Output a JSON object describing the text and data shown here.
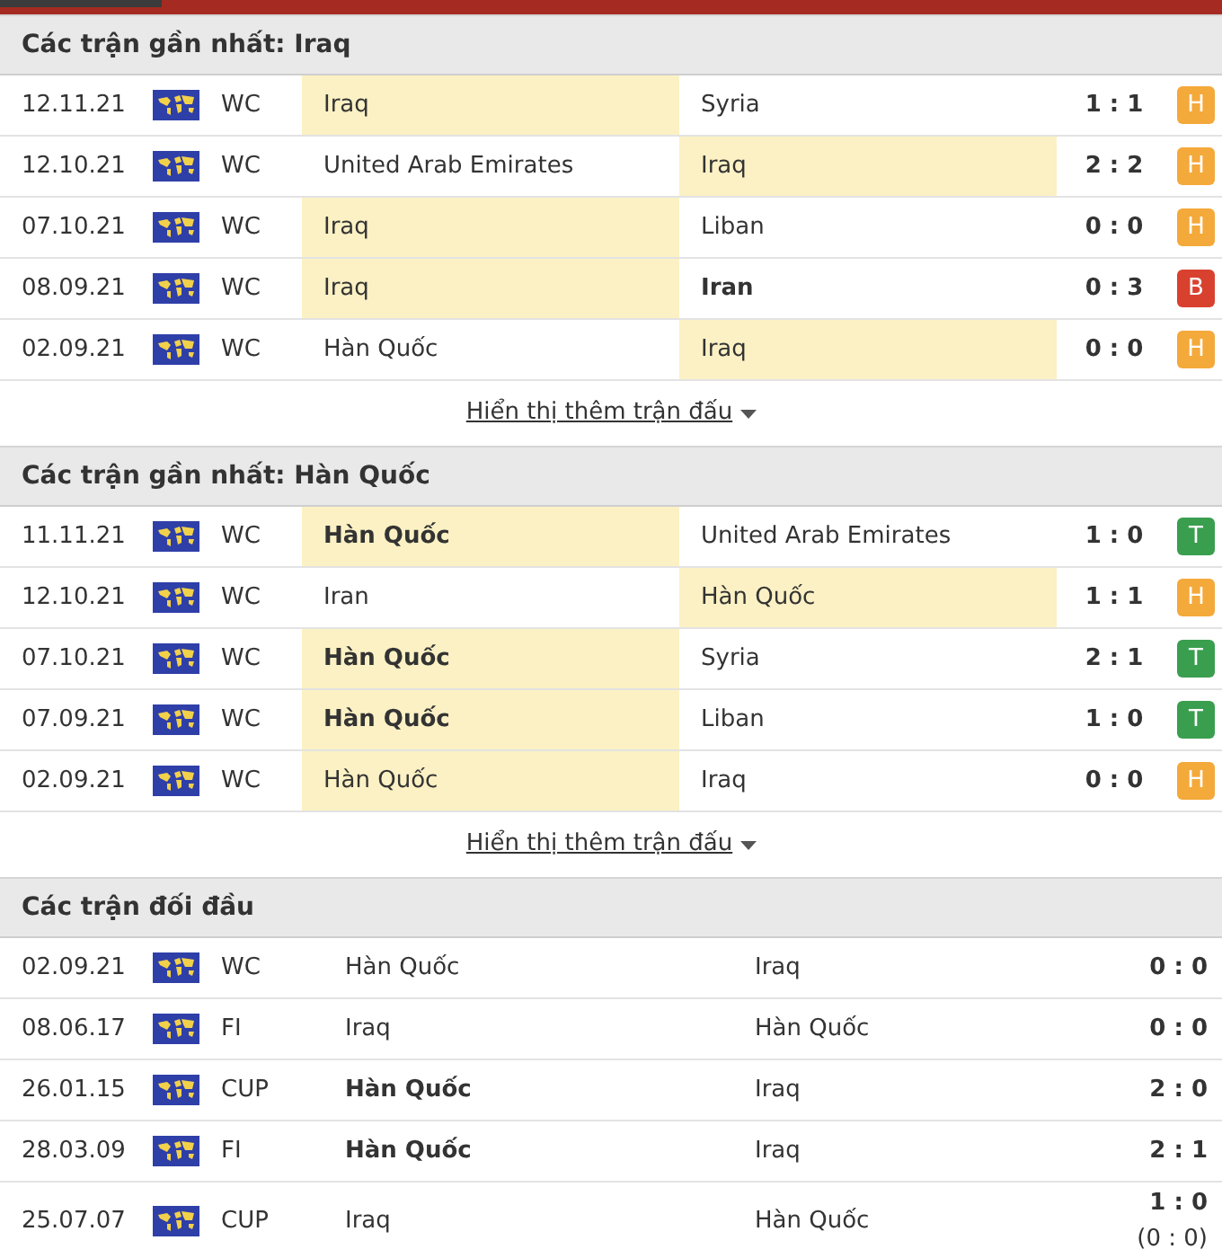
{
  "sections": [
    {
      "title": "Các trận gần nhất: Iraq",
      "show_more": "Hiển thị thêm trận đấu",
      "matches": [
        {
          "date": "12.11.21",
          "competition": "WC",
          "home": {
            "name": "Iraq",
            "bold": false,
            "highlighted": true
          },
          "away": {
            "name": "Syria",
            "bold": false,
            "highlighted": false
          },
          "score": "1 : 1",
          "result": {
            "label": "H",
            "kind": "draw"
          }
        },
        {
          "date": "12.10.21",
          "competition": "WC",
          "home": {
            "name": "United Arab Emirates",
            "bold": false,
            "highlighted": false
          },
          "away": {
            "name": "Iraq",
            "bold": false,
            "highlighted": true
          },
          "score": "2 : 2",
          "result": {
            "label": "H",
            "kind": "draw"
          }
        },
        {
          "date": "07.10.21",
          "competition": "WC",
          "home": {
            "name": "Iraq",
            "bold": false,
            "highlighted": true
          },
          "away": {
            "name": "Liban",
            "bold": false,
            "highlighted": false
          },
          "score": "0 : 0",
          "result": {
            "label": "H",
            "kind": "draw"
          }
        },
        {
          "date": "08.09.21",
          "competition": "WC",
          "home": {
            "name": "Iraq",
            "bold": false,
            "highlighted": true
          },
          "away": {
            "name": "Iran",
            "bold": true,
            "highlighted": false
          },
          "score": "0 : 3",
          "result": {
            "label": "B",
            "kind": "loss"
          }
        },
        {
          "date": "02.09.21",
          "competition": "WC",
          "home": {
            "name": "Hàn Quốc",
            "bold": false,
            "highlighted": false
          },
          "away": {
            "name": "Iraq",
            "bold": false,
            "highlighted": true
          },
          "score": "0 : 0",
          "result": {
            "label": "H",
            "kind": "draw"
          }
        }
      ]
    },
    {
      "title": "Các trận gần nhất: Hàn Quốc",
      "show_more": "Hiển thị thêm trận đấu",
      "matches": [
        {
          "date": "11.11.21",
          "competition": "WC",
          "home": {
            "name": "Hàn Quốc",
            "bold": true,
            "highlighted": true
          },
          "away": {
            "name": "United Arab Emirates",
            "bold": false,
            "highlighted": false
          },
          "score": "1 : 0",
          "result": {
            "label": "T",
            "kind": "win"
          }
        },
        {
          "date": "12.10.21",
          "competition": "WC",
          "home": {
            "name": "Iran",
            "bold": false,
            "highlighted": false
          },
          "away": {
            "name": "Hàn Quốc",
            "bold": false,
            "highlighted": true
          },
          "score": "1 : 1",
          "result": {
            "label": "H",
            "kind": "draw"
          }
        },
        {
          "date": "07.10.21",
          "competition": "WC",
          "home": {
            "name": "Hàn Quốc",
            "bold": true,
            "highlighted": true
          },
          "away": {
            "name": "Syria",
            "bold": false,
            "highlighted": false
          },
          "score": "2 : 1",
          "result": {
            "label": "T",
            "kind": "win"
          }
        },
        {
          "date": "07.09.21",
          "competition": "WC",
          "home": {
            "name": "Hàn Quốc",
            "bold": true,
            "highlighted": true
          },
          "away": {
            "name": "Liban",
            "bold": false,
            "highlighted": false
          },
          "score": "1 : 0",
          "result": {
            "label": "T",
            "kind": "win"
          }
        },
        {
          "date": "02.09.21",
          "competition": "WC",
          "home": {
            "name": "Hàn Quốc",
            "bold": false,
            "highlighted": true
          },
          "away": {
            "name": "Iraq",
            "bold": false,
            "highlighted": false
          },
          "score": "0 : 0",
          "result": {
            "label": "H",
            "kind": "draw"
          }
        }
      ]
    },
    {
      "title": "Các trận đối đầu",
      "matches": [
        {
          "date": "02.09.21",
          "competition": "WC",
          "home": {
            "name": "Hàn Quốc",
            "bold": false,
            "highlighted": false
          },
          "away": {
            "name": "Iraq",
            "bold": false,
            "highlighted": false
          },
          "score": "0 : 0"
        },
        {
          "date": "08.06.17",
          "competition": "FI",
          "home": {
            "name": "Iraq",
            "bold": false,
            "highlighted": false
          },
          "away": {
            "name": "Hàn Quốc",
            "bold": false,
            "highlighted": false
          },
          "score": "0 : 0"
        },
        {
          "date": "26.01.15",
          "competition": "CUP",
          "home": {
            "name": "Hàn Quốc",
            "bold": true,
            "highlighted": false
          },
          "away": {
            "name": "Iraq",
            "bold": false,
            "highlighted": false
          },
          "score": "2 : 0"
        },
        {
          "date": "28.03.09",
          "competition": "FI",
          "home": {
            "name": "Hàn Quốc",
            "bold": true,
            "highlighted": false
          },
          "away": {
            "name": "Iraq",
            "bold": false,
            "highlighted": false
          },
          "score": "2 : 1"
        },
        {
          "date": "25.07.07",
          "competition": "CUP",
          "home": {
            "name": "Iraq",
            "bold": false,
            "highlighted": false
          },
          "away": {
            "name": "Hàn Quốc",
            "bold": false,
            "highlighted": false
          },
          "score": "1 : 0",
          "score_note": "(0 : 0)"
        }
      ]
    }
  ]
}
